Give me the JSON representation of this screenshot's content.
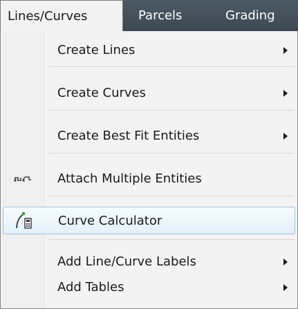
{
  "menubar": {
    "items": [
      {
        "label": "Lines/Curves"
      },
      {
        "label": "Parcels"
      },
      {
        "label": "Grading"
      }
    ]
  },
  "menu": {
    "items": [
      {
        "label": "Create Lines",
        "submenu": true
      },
      {
        "label": "Create Curves",
        "submenu": true
      },
      {
        "label": "Create Best Fit Entities",
        "submenu": true
      },
      {
        "label": "Attach Multiple Entities",
        "icon": "attach-multiple-entities-icon"
      },
      {
        "label": "Curve Calculator",
        "icon": "curve-calculator-icon",
        "highlighted": true
      },
      {
        "label": "Add Line/Curve Labels",
        "submenu": true
      },
      {
        "label": "Add Tables",
        "submenu": true
      }
    ]
  },
  "colors": {
    "menubar_bg": "#3f4a54",
    "menu_bg": "#f3f3f3",
    "highlight_border": "#9ec4e6"
  }
}
